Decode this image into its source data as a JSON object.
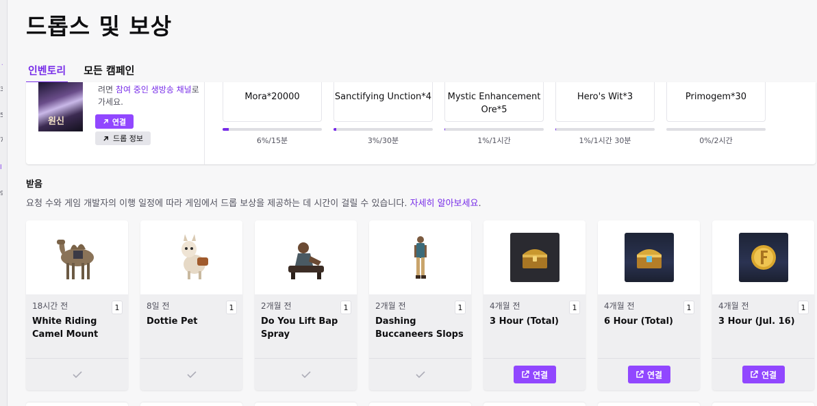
{
  "left_rail": [
    "ㅓ",
    "3",
    "5",
    "7",
    "l",
    "9"
  ],
  "page": {
    "title": "드롭스 및 보상"
  },
  "tabs": [
    {
      "label": "인벤토리",
      "active": true
    },
    {
      "label": "모든 캠페인",
      "active": false
    }
  ],
  "campaign": {
    "thumb_text": "원신",
    "desc_prefix": "려면 ",
    "desc_link": "참여 중인 생방송 채널",
    "desc_suffix": "로 가세요.",
    "connect_label": "연결",
    "drop_info_label": "드롭 정보",
    "drops": [
      {
        "name": "Mora*20000",
        "progress": 6,
        "label": "6%/15분"
      },
      {
        "name": "Sanctifying Unction*4",
        "progress": 3,
        "label": "3%/30분"
      },
      {
        "name": "Mystic Enhancement Ore*5",
        "progress": 1,
        "label": "1%/1시간"
      },
      {
        "name": "Hero's Wit*3",
        "progress": 1,
        "label": "1%/1시간 30분"
      },
      {
        "name": "Primogem*30",
        "progress": 0,
        "label": "0%/2시간"
      }
    ]
  },
  "claimed": {
    "title": "받음",
    "desc": "요청 수와 게임 개발자의 이행 일정에 따라 게임에서 드롭 보상을 제공하는 데 시간이 걸릴 수 있습니다. ",
    "learn_more": "자세히 알아보세요",
    "learn_more_suffix": ".",
    "items": [
      {
        "time": "18시간 전",
        "name": "White Riding Camel Mount",
        "count": "1",
        "image": "camel",
        "action": "check"
      },
      {
        "time": "8일 전",
        "name": "Dottie Pet",
        "count": "1",
        "image": "llama",
        "action": "check"
      },
      {
        "time": "2개월 전",
        "name": "Do You Lift Bap Spray",
        "count": "1",
        "image": "lifter",
        "action": "check"
      },
      {
        "time": "2개월 전",
        "name": "Dashing Buccaneers Slops",
        "count": "1",
        "image": "pirate",
        "action": "check"
      },
      {
        "time": "4개월 전",
        "name": "3 Hour (Total)",
        "count": "1",
        "image": "chest-dark",
        "action": "connect",
        "action_label": "연결"
      },
      {
        "time": "4개월 전",
        "name": "6 Hour (Total)",
        "count": "1",
        "image": "chest-night",
        "action": "connect",
        "action_label": "연결"
      },
      {
        "time": "4개월 전",
        "name": "3 Hour (Jul. 16)",
        "count": "1",
        "image": "coin-night",
        "action": "connect",
        "action_label": "연결"
      }
    ]
  },
  "colors": {
    "accent": "#772ce8",
    "button": "#9147ff",
    "muted": "#53535f"
  }
}
